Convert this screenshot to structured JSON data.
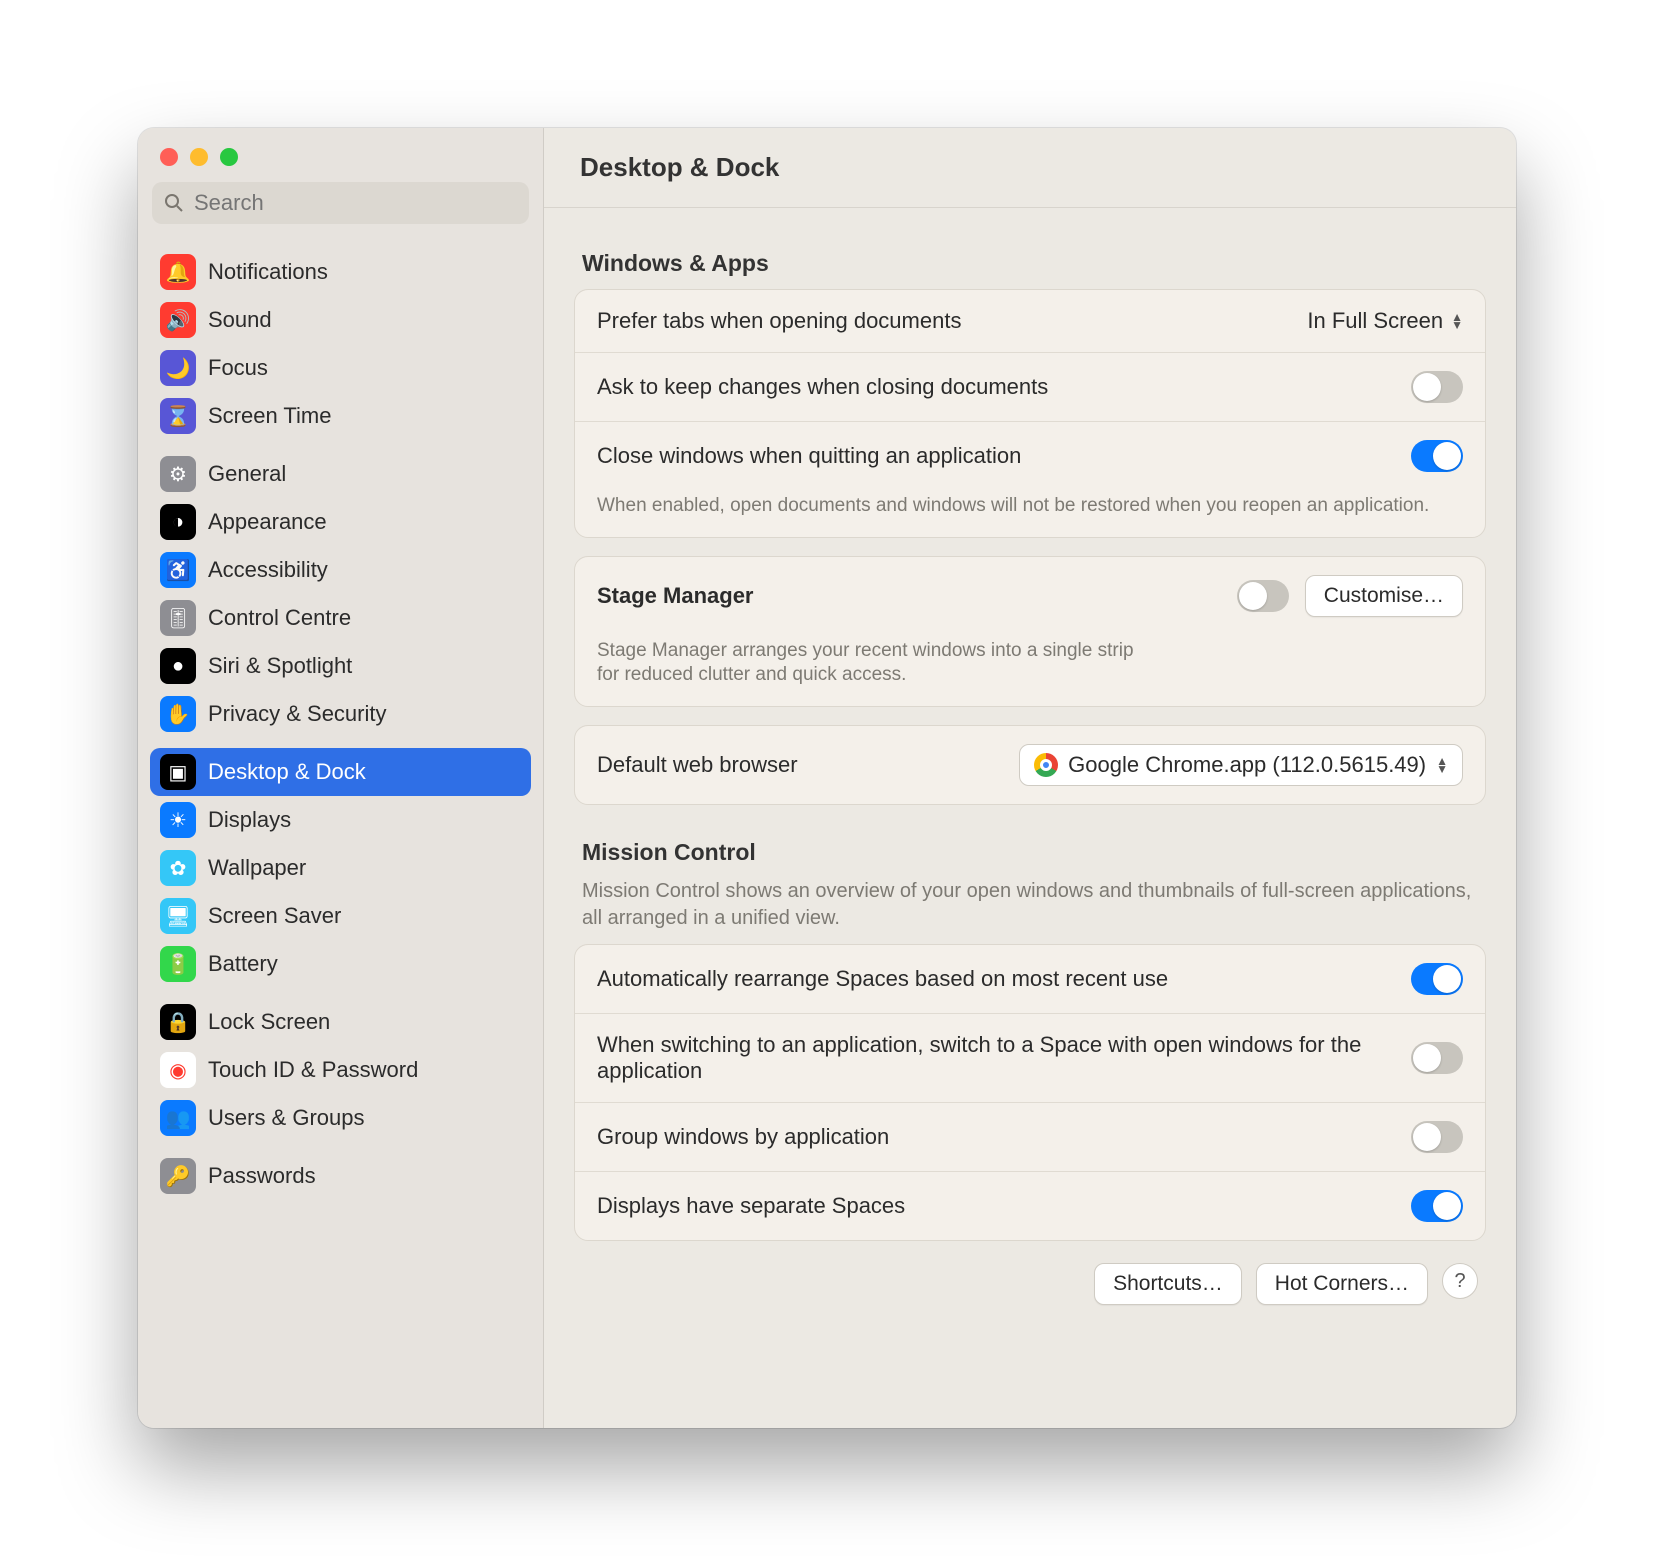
{
  "header": {
    "title": "Desktop & Dock"
  },
  "search": {
    "placeholder": "Search"
  },
  "sidebar": {
    "groups": [
      [
        {
          "label": "Notifications",
          "bg": "#ff3b30"
        },
        {
          "label": "Sound",
          "bg": "#ff3b30"
        },
        {
          "label": "Focus",
          "bg": "#5856d6"
        },
        {
          "label": "Screen Time",
          "bg": "#5856d6"
        }
      ],
      [
        {
          "label": "General",
          "bg": "#8e8e93"
        },
        {
          "label": "Appearance",
          "bg": "#000"
        },
        {
          "label": "Accessibility",
          "bg": "#0a7aff"
        },
        {
          "label": "Control Centre",
          "bg": "#8e8e93"
        },
        {
          "label": "Siri & Spotlight",
          "bg": "#000"
        },
        {
          "label": "Privacy & Security",
          "bg": "#0a7aff"
        }
      ],
      [
        {
          "label": "Desktop & Dock",
          "bg": "#000",
          "selected": true
        },
        {
          "label": "Displays",
          "bg": "#0a7aff"
        },
        {
          "label": "Wallpaper",
          "bg": "#34c7f7"
        },
        {
          "label": "Screen Saver",
          "bg": "#34c7f7"
        },
        {
          "label": "Battery",
          "bg": "#32d74b"
        }
      ],
      [
        {
          "label": "Lock Screen",
          "bg": "#000"
        },
        {
          "label": "Touch ID & Password",
          "bg": "#fff",
          "fg": "#ff3b30"
        },
        {
          "label": "Users & Groups",
          "bg": "#0a7aff"
        }
      ],
      [
        {
          "label": "Passwords",
          "bg": "#8e8e93"
        }
      ]
    ]
  },
  "windows_apps": {
    "section_title": "Windows & Apps",
    "prefer_tabs": {
      "label": "Prefer tabs when opening documents",
      "value": "In Full Screen"
    },
    "ask_keep": {
      "label": "Ask to keep changes when closing documents",
      "on": false
    },
    "close_quit": {
      "label": "Close windows when quitting an application",
      "sub": "When enabled, open documents and windows will not be restored when you reopen an application.",
      "on": true
    }
  },
  "stage_manager": {
    "title": "Stage Manager",
    "desc": "Stage Manager arranges your recent windows into a single strip for reduced clutter and quick access.",
    "on": false,
    "customise": "Customise…"
  },
  "default_browser": {
    "label": "Default web browser",
    "value": "Google Chrome.app (112.0.5615.49)"
  },
  "mission_control": {
    "title": "Mission Control",
    "desc": "Mission Control shows an overview of your open windows and thumbnails of full-screen applications, all arranged in a unified view.",
    "auto_rearrange": {
      "label": "Automatically rearrange Spaces based on most recent use",
      "on": true
    },
    "switch_space": {
      "label": "When switching to an application, switch to a Space with open windows for the application",
      "on": false
    },
    "group_windows": {
      "label": "Group windows by application",
      "on": false
    },
    "separate_spaces": {
      "label": "Displays have separate Spaces",
      "on": true
    }
  },
  "footer": {
    "shortcuts": "Shortcuts…",
    "hot_corners": "Hot Corners…"
  }
}
